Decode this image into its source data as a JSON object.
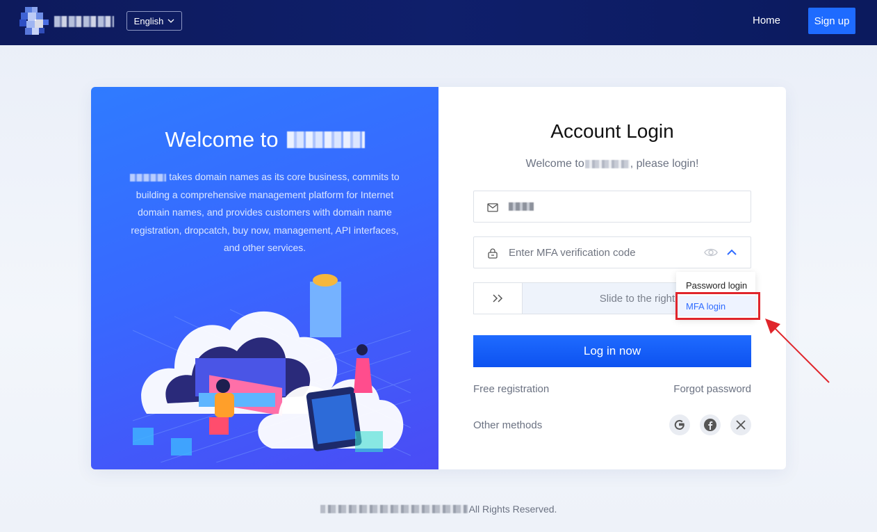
{
  "header": {
    "language": "English",
    "home": "Home",
    "signup": "Sign up"
  },
  "left": {
    "welcome_prefix": "Welcome to",
    "description": "takes domain names as its core business, commits to building a comprehensive management platform for Internet domain names, and provides customers with domain name registration, dropcatch, buy now, management, API interfaces, and other services."
  },
  "login": {
    "title": "Account Login",
    "subtitle_prefix": "Welcome to",
    "subtitle_suffix": ", please login!",
    "mfa_placeholder": "Enter MFA verification code",
    "slider_text": "Slide to the right",
    "dropdown": [
      "Password login",
      "MFA login"
    ],
    "button": "Log in now",
    "free_registration": "Free registration",
    "forgot_password": "Forgot password",
    "other_methods": "Other methods",
    "social_icons": [
      "google-icon",
      "facebook-icon",
      "x-icon"
    ]
  },
  "footer": {
    "suffix": "All Rights Reserved."
  },
  "colors": {
    "accent": "#1e6bff",
    "header_bg": "#0d1a5c",
    "highlight": "#e0252b"
  }
}
